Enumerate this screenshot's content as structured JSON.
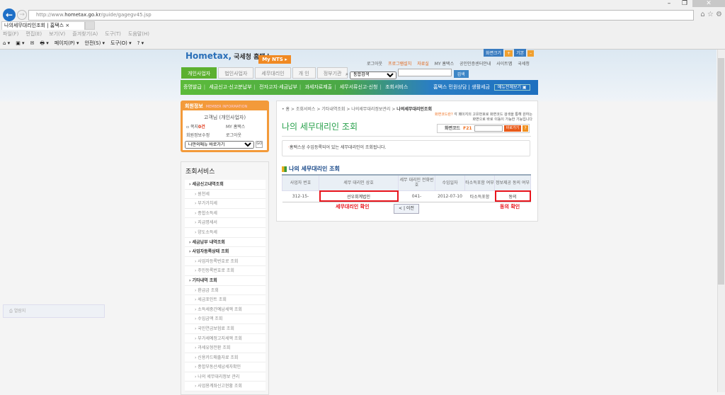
{
  "browser": {
    "url_prefix": "http://www.",
    "url_domain": "hometax.go.kr",
    "url_path": "/guide/gagegv45.jsp",
    "tab_title": "나의세무대리인조회 | 홈택스",
    "tab_close": "×",
    "menu": [
      "파일(F)",
      "편집(E)",
      "보기(V)",
      "즐겨찾기(A)",
      "도구(T)",
      "도움말(H)"
    ],
    "toolbar": [
      "⌂ ▾",
      "▣ ▾",
      "✉",
      "🖶 ▾",
      "페이지(P) ▾",
      "안전(S) ▾",
      "도구(O) ▾",
      "? ▾"
    ],
    "window_buttons": [
      "–",
      "❐",
      "✕"
    ],
    "ie_tools": "⌂ ☆ ⚙"
  },
  "header": {
    "logo": "Hometax,",
    "logo_sub": "국세청 홈택스",
    "mynts": "My NTS ▸",
    "util_links": [
      "로그아웃",
      "프로그램설치",
      "자료실",
      "MY 홈택스",
      "공인인증센터안내",
      "사이트맵",
      "국세청"
    ],
    "size_buttons": [
      "화면크기",
      "+",
      "기본",
      "–"
    ],
    "tabs": [
      "개인사업자",
      "법인사업자",
      "세무대리인",
      "개 인",
      "정부기관"
    ],
    "search_select": "통합검색",
    "search_button": "검색",
    "gnav": [
      "증명발급",
      "세금신고·신고분납부",
      "전자고지·세금납부",
      "과세자료제출",
      "세무서류신고·신청",
      "조회서비스"
    ],
    "gnav_right": [
      "홈택스 민원상담",
      "생활세금",
      "메뉴전체보기 ▣"
    ]
  },
  "login": {
    "title": "회원정보",
    "title_en": "MEMBER INFORMATION",
    "name": "고객님 (개인사업자)",
    "links": [
      {
        "pre": "쪽지 ",
        "count": "0건"
      },
      {
        "pre": "MY 홈택스"
      },
      {
        "pre": "회원정보수정"
      },
      {
        "pre": "로그아웃"
      }
    ],
    "quick_select": "나만의메뉴 바로가기",
    "go": "GO"
  },
  "sidebar": {
    "title": "조회서비스",
    "items": [
      {
        "label": "› 세금신고내역조회",
        "group": true
      },
      {
        "label": "› 원천세"
      },
      {
        "label": "› 부가가치세"
      },
      {
        "label": "› 종합소득세"
      },
      {
        "label": "› 지급명세서"
      },
      {
        "label": "› 양도소득세"
      },
      {
        "label": "› 세금납부 내역조회",
        "group": true
      },
      {
        "label": "› 사업자등록상태 조회",
        "group": true
      },
      {
        "label": "› 사업자등록번호로 조회"
      },
      {
        "label": "› 주민등록번호로 조회"
      },
      {
        "label": "› 기타내역 조회",
        "group": true
      },
      {
        "label": "› 환급금 조회"
      },
      {
        "label": "› 세금포인트 조회"
      },
      {
        "label": "› 소득세중간예납세액 조회"
      },
      {
        "label": "› 수입금액 조회"
      },
      {
        "label": "› 국민연금보험료 조회"
      },
      {
        "label": "› 부가세예정고지세액 조회"
      },
      {
        "label": "› 과세유형전환 조회"
      },
      {
        "label": "› 신용카드매출자료 조회"
      },
      {
        "label": "› 종합부동산세납세자확인"
      },
      {
        "label": "› 나의 세무대리정보 관리"
      },
      {
        "label": "› 사업용계좌신고현황 조회"
      }
    ]
  },
  "main": {
    "breadcrumb": [
      "홈",
      "조회서비스",
      "기타내역조회",
      "나의세무대리정보관리"
    ],
    "breadcrumb_current": "나의세무대리인조회",
    "title": "나의 세무대리인 조회",
    "help_link": "화면코드란?",
    "help_text": "각 페이지의 고유번호로 화면코드 검색을 통해 원하는 화면으로 바로 이동이 가능한 기능입니다",
    "code_label": "화면코드",
    "code_value": "F21",
    "code_go": "바로가기",
    "code_help": "?",
    "info": "홈택스상 수임등록되어 있는 세무대리인이 조회됩니다.",
    "section_title": "나의 세무대리인 조회",
    "table": {
      "headers": [
        "사업자 번호",
        "세무 대리인 상호",
        "세무 대리인 전화번호",
        "수임일자",
        "타소득포함 여부",
        "정보제공 동의 여부"
      ],
      "rows": [
        [
          "312-15-",
          "선우회계법인",
          "041-",
          "2012-07-10",
          "타소득포함",
          "동의"
        ]
      ]
    },
    "annotation_agent": "세무대리인 확인",
    "annotation_consent": "동의 확인",
    "prev_button": "< | 이전"
  },
  "quicklink": "열람지",
  "colors": {
    "green": "#27a04a",
    "orange": "#f39a3a",
    "highlight": "#e8141c",
    "blue": "#1e6fbf"
  }
}
